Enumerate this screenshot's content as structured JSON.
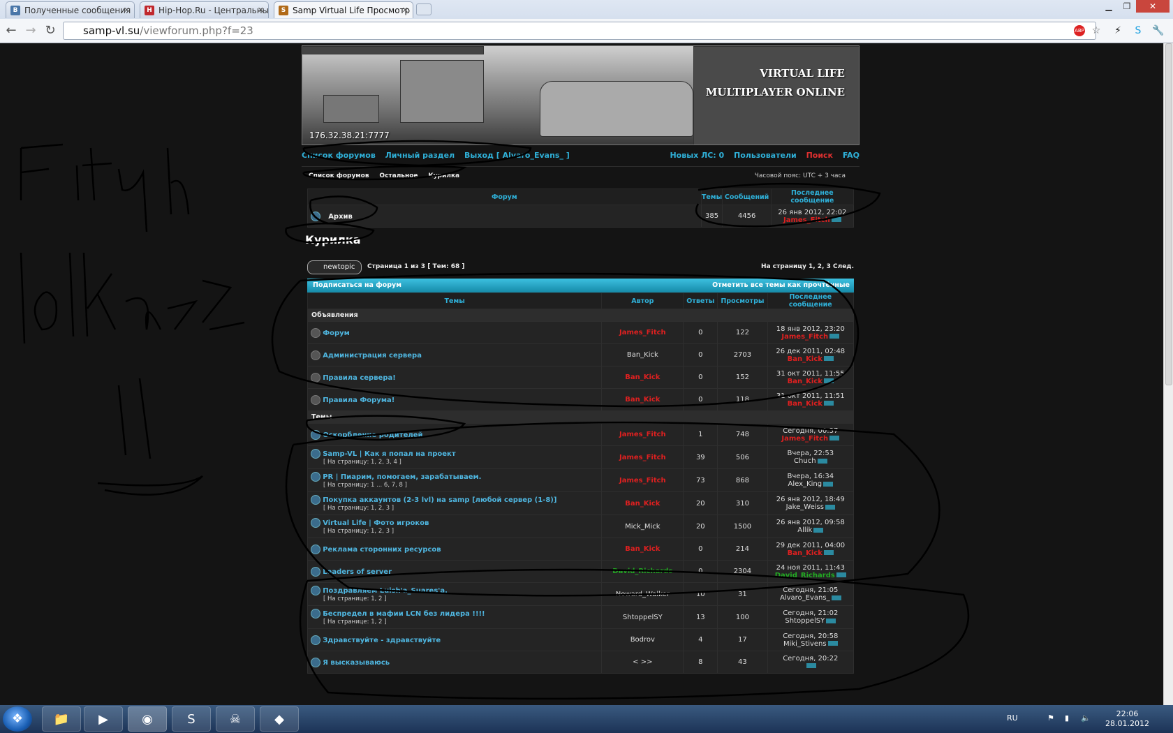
{
  "tabs": [
    {
      "label": "Полученные сообщения | ",
      "favicon": "vk-icon"
    },
    {
      "label": "Hip-Hop.Ru - Центральны",
      "favicon": "hiphop-icon"
    },
    {
      "label": "Samp Virtual Life Просмотр",
      "favicon": "samp-icon"
    }
  ],
  "address": {
    "host": "samp-vl.su",
    "path": "/viewforum.php?f=23"
  },
  "banner": {
    "line1": "VIRTUAL LIFE",
    "line2": "MULTIPLAYER ONLINE",
    "ip": "176.32.38.21:7777"
  },
  "topnav": {
    "left": [
      "Список форумов",
      "Личный раздел",
      "Выход [ Alvaro_Evans_ ]"
    ],
    "right": [
      "Новых ЛС: 0",
      "Пользователи",
      "Поиск",
      "FAQ"
    ]
  },
  "crumbs": {
    "items": [
      "Список форумов",
      "Остальное",
      "Курилка"
    ],
    "timezone": "Часовой пояс: UTC + 3 часа"
  },
  "subforum": {
    "headers": [
      "Форум",
      "Темы",
      "Сообщений",
      "Последнее сообщение"
    ],
    "row": {
      "name": "Архив",
      "topics": "385",
      "posts": "4456",
      "last_date": "26 янв 2012, 22:02",
      "last_author": "James_Fitch"
    }
  },
  "forum_title": "Курилка",
  "pagebar": {
    "newtopic": "newtopic",
    "info": "Страница 1 из 3  [ Тем: 68 ]",
    "nav": "На страницу 1, 2, 3  След."
  },
  "cyanbar": {
    "left": "Подписаться на форум",
    "right": "Отметить все темы как прочтённые"
  },
  "topics_headers": [
    "Темы",
    "Автор",
    "Ответы",
    "Просмотры",
    "Последнее сообщение"
  ],
  "sections": {
    "announcements": "Объявления",
    "topics": "Темы"
  },
  "announcements": [
    {
      "title": "Форум",
      "author": "James_Fitch",
      "author_color": "red",
      "replies": "0",
      "views": "122",
      "last_date": "18 янв 2012, 23:20",
      "last_author": "James_Fitch",
      "last_color": "red"
    },
    {
      "title": "Администрация сервера",
      "author": "Ban_Kick",
      "author_color": "plain",
      "replies": "0",
      "views": "2703",
      "last_date": "26 дек 2011, 02:48",
      "last_author": "Ban_Kick",
      "last_color": "red"
    },
    {
      "title": "Правила сервера!",
      "author": "Ban_Kick",
      "author_color": "red",
      "replies": "0",
      "views": "152",
      "last_date": "31 окт 2011, 11:55",
      "last_author": "Ban_Kick",
      "last_color": "red"
    },
    {
      "title": "Правила Форума!",
      "author": "Ban_Kick",
      "author_color": "red",
      "replies": "0",
      "views": "118",
      "last_date": "31 окт 2011, 11:51",
      "last_author": "Ban_Kick",
      "last_color": "red"
    }
  ],
  "topics": [
    {
      "title": "Оскорбление родителей",
      "pages": "",
      "author": "James_Fitch",
      "author_color": "red",
      "replies": "1",
      "views": "748",
      "last_date": "Сегодня, 00:37",
      "last_author": "James_Fitch",
      "last_color": "red"
    },
    {
      "title": "Samp-VL | Как я попал на проект",
      "pages": "[ На страницу: 1, 2, 3, 4 ]",
      "author": "James_Fitch",
      "author_color": "red",
      "replies": "39",
      "views": "506",
      "last_date": "Вчера, 22:53",
      "last_author": "Chuch",
      "last_color": "plain"
    },
    {
      "title": "PR | Пиарим, помогаем, зарабатываем.",
      "pages": "[ На страницу: 1 ... 6, 7, 8 ]",
      "author": "James_Fitch",
      "author_color": "red",
      "replies": "73",
      "views": "868",
      "last_date": "Вчера, 16:34",
      "last_author": "Alex_King",
      "last_color": "plain"
    },
    {
      "title": "Покупка аккаунтов (2-3 lvl) на samp [любой сервер (1-8)]",
      "pages": "[ На страницу: 1, 2, 3 ]",
      "author": "Ban_Kick",
      "author_color": "red",
      "replies": "20",
      "views": "310",
      "last_date": "26 янв 2012, 18:49",
      "last_author": "Jake_Weiss",
      "last_color": "plain"
    },
    {
      "title": "Virtual Life | Фото игроков",
      "pages": "[ На страницу: 1, 2, 3 ]",
      "author": "Mick_Mick",
      "author_color": "plain",
      "replies": "20",
      "views": "1500",
      "last_date": "26 янв 2012, 09:58",
      "last_author": "Allik",
      "last_color": "plain"
    },
    {
      "title": "Реклама сторонних ресурсов",
      "pages": "",
      "author": "Ban_Kick",
      "author_color": "red",
      "replies": "0",
      "views": "214",
      "last_date": "29 дек 2011, 04:00",
      "last_author": "Ban_Kick",
      "last_color": "red"
    },
    {
      "title": "Leaders of server",
      "pages": "",
      "author": "David_Richards",
      "author_color": "green",
      "replies": "0",
      "views": "2304",
      "last_date": "24 ноя 2011, 11:43",
      "last_author": "David_Richards",
      "last_color": "green"
    },
    {
      "title": "Поздравляем Luish'a_Suares'a.",
      "pages": "[ На странице: 1, 2 ]",
      "author": "Noward_Walker",
      "author_color": "plain",
      "replies": "10",
      "views": "31",
      "last_date": "Сегодня, 21:05",
      "last_author": "Alvaro_Evans_",
      "last_color": "plain"
    },
    {
      "title": "Беспредел в мафии LCN без лидера !!!!",
      "pages": "[ На странице: 1, 2 ]",
      "author": "ShtoppelSY",
      "author_color": "plain",
      "replies": "13",
      "views": "100",
      "last_date": "Сегодня, 21:02",
      "last_author": "ShtoppelSY",
      "last_color": "plain"
    },
    {
      "title": "Здравствуйте - здравствуйте",
      "pages": "",
      "author": "Bodrov",
      "author_color": "plain",
      "replies": "4",
      "views": "17",
      "last_date": "Сегодня, 20:58",
      "last_author": "Miki_Stivens",
      "last_color": "plain"
    },
    {
      "title": "Я высказываюсь",
      "pages": "",
      "author": "< >>",
      "author_color": "plain",
      "replies": "8",
      "views": "43",
      "last_date": "Сегодня, 20:22",
      "last_author": "",
      "last_color": "plain"
    }
  ],
  "scribble_text": "Fitch lolka<3 !!",
  "taskbar": {
    "lang": "RU",
    "time": "22:06",
    "date": "28.01.2012"
  },
  "colors": {
    "accent": "#2fb0d8",
    "admin_red": "#e02020",
    "leader_green": "#22aa22",
    "cyan_bar": "#1a9cc0"
  }
}
